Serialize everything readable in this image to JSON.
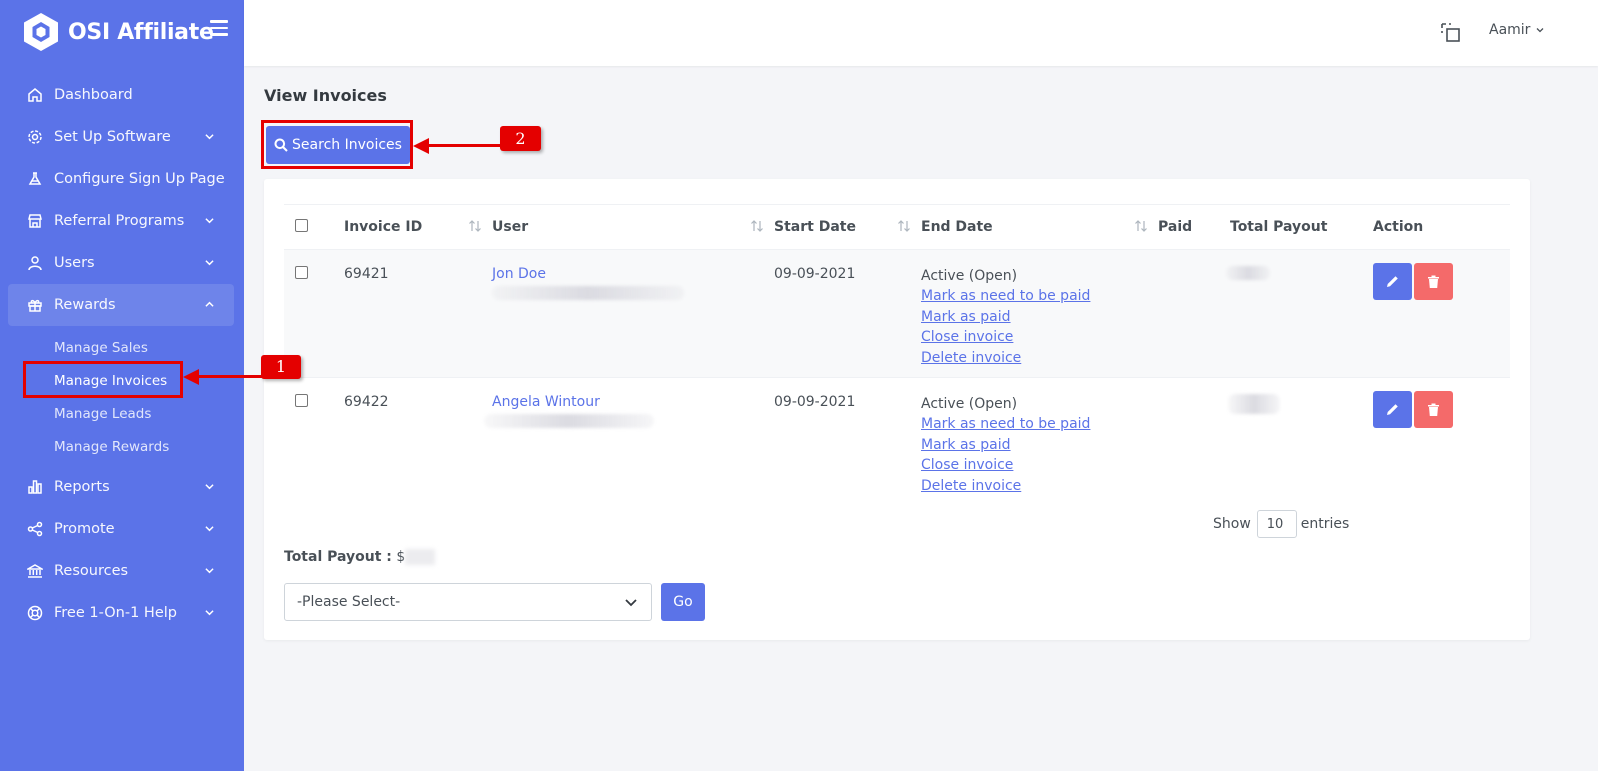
{
  "brand": {
    "name": "OSI Affiliate"
  },
  "topbar": {
    "user_name": "Aamir"
  },
  "sidebar": {
    "items": [
      {
        "label": "Dashboard",
        "icon": "home-icon",
        "has_chevron": false
      },
      {
        "label": "Set Up Software",
        "icon": "gear-icon",
        "has_chevron": true
      },
      {
        "label": "Configure Sign Up Page",
        "icon": "flask-icon",
        "has_chevron": false
      },
      {
        "label": "Referral Programs",
        "icon": "store-icon",
        "has_chevron": true
      },
      {
        "label": "Users",
        "icon": "user-icon",
        "has_chevron": true
      },
      {
        "label": "Rewards",
        "icon": "gift-icon",
        "has_chevron": true,
        "expanded": true
      },
      {
        "label": "Reports",
        "icon": "bar-chart-icon",
        "has_chevron": true
      },
      {
        "label": "Promote",
        "icon": "share-icon",
        "has_chevron": true
      },
      {
        "label": "Resources",
        "icon": "bank-icon",
        "has_chevron": true
      },
      {
        "label": "Free 1-On-1 Help",
        "icon": "lifebuoy-icon",
        "has_chevron": true
      }
    ],
    "rewards_sub": [
      "Manage Sales",
      "Manage Invoices",
      "Manage Leads",
      "Manage Rewards"
    ]
  },
  "page": {
    "title": "View Invoices",
    "search_button": "Search Invoices"
  },
  "annotations": {
    "callout_1": "1",
    "callout_2": "2"
  },
  "table": {
    "headers": [
      "Invoice ID",
      "User",
      "Start Date",
      "End Date",
      "Paid",
      "Total Payout",
      "Action"
    ],
    "rows": [
      {
        "invoice_id": "69421",
        "user": "Jon Doe",
        "start_date": "09-09-2021",
        "status": "Active (Open)",
        "links": [
          "Mark as need to be paid",
          "Mark as paid",
          "Close invoice",
          "Delete invoice"
        ]
      },
      {
        "invoice_id": "69422",
        "user": "Angela Wintour",
        "start_date": "09-09-2021",
        "status": "Active (Open)",
        "links": [
          "Mark as need to be paid",
          "Mark as paid",
          "Close invoice",
          "Delete invoice"
        ]
      }
    ]
  },
  "entries": {
    "show_label": "Show",
    "value": "10",
    "suffix": "entries"
  },
  "footer": {
    "total_label": "Total Payout :",
    "total_prefix": "$",
    "select_placeholder": "-Please Select-",
    "go_label": "Go"
  },
  "colors": {
    "primary": "#5b73e8",
    "danger": "#f46a6a",
    "callout": "#e40000"
  }
}
